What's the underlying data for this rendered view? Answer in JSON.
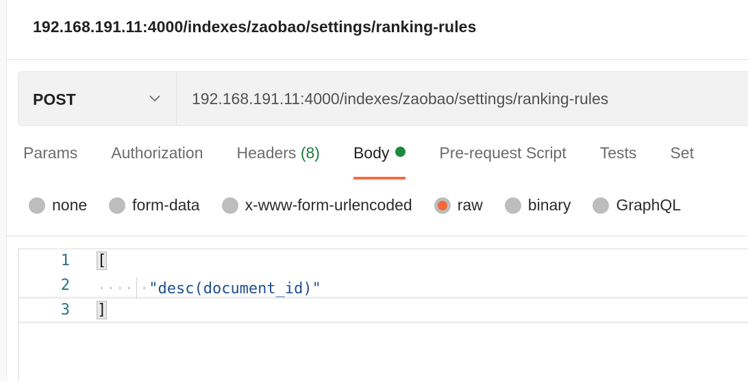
{
  "window": {
    "title": "192.168.191.11:4000/indexes/zaobao/settings/ranking-rules"
  },
  "request": {
    "method": "POST",
    "url": "192.168.191.11:4000/indexes/zaobao/settings/ranking-rules"
  },
  "tabs": [
    {
      "label": "Params",
      "active": false
    },
    {
      "label": "Authorization",
      "active": false
    },
    {
      "label": "Headers",
      "count": "(8)",
      "active": false
    },
    {
      "label": "Body",
      "active": true,
      "indicator": "green-dot"
    },
    {
      "label": "Pre-request Script",
      "active": false
    },
    {
      "label": "Tests",
      "active": false
    },
    {
      "label": "Set",
      "active": false
    }
  ],
  "body_types": [
    {
      "label": "none",
      "checked": false
    },
    {
      "label": "form-data",
      "checked": false
    },
    {
      "label": "x-www-form-urlencoded",
      "checked": false
    },
    {
      "label": "raw",
      "checked": true
    },
    {
      "label": "binary",
      "checked": false
    },
    {
      "label": "GraphQL",
      "checked": false
    }
  ],
  "editor": {
    "lines": [
      {
        "num": "1",
        "text": "["
      },
      {
        "num": "2",
        "text": "\"desc(document_id)\""
      },
      {
        "num": "3",
        "text": "]"
      }
    ]
  },
  "colors": {
    "accent": "#ef6e45",
    "active_indicator": "#1c8a3e",
    "header_count": "#1c7a3d",
    "string_token": "#1d4f91",
    "line_number": "#2c6f80"
  }
}
